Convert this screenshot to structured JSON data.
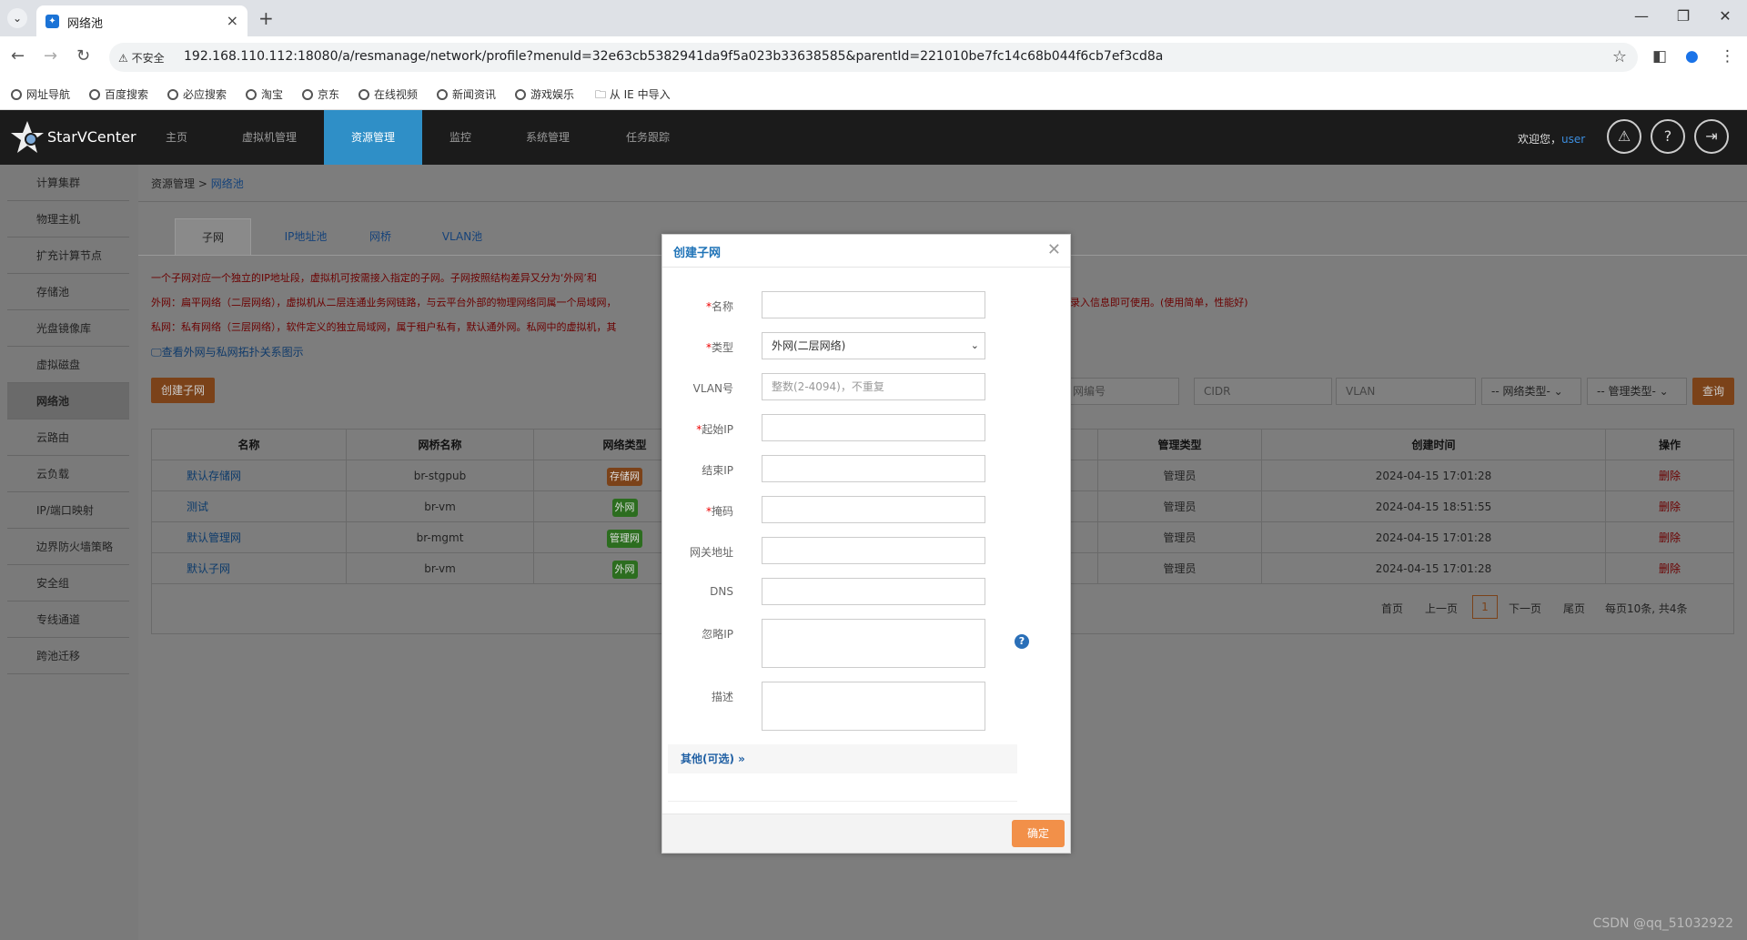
{
  "browser": {
    "tab_title": "网络池",
    "security_label": "不安全",
    "url": "192.168.110.112:18080/a/resmanage/network/profile?menuId=32e63cb5382941da9f5a023b33638585&parentId=221010be7fc14c68b044f6cb7ef3cd8a",
    "bookmarks": [
      "网址导航",
      "百度搜索",
      "必应搜索",
      "淘宝",
      "京东",
      "在线视频",
      "新闻资讯",
      "游戏娱乐",
      "从 IE 中导入"
    ]
  },
  "header": {
    "logo_text": "StarVCenter",
    "nav": [
      "主页",
      "虚拟机管理",
      "资源管理",
      "监控",
      "系统管理",
      "任务跟踪"
    ],
    "active_nav": "资源管理",
    "welcome": "欢迎您，",
    "user": "user"
  },
  "sidebar": {
    "items": [
      "计算集群",
      "物理主机",
      "扩充计算节点",
      "存储池",
      "光盘镜像库",
      "虚拟磁盘",
      "网络池",
      "云路由",
      "云负载",
      "IP/端口映射",
      "边界防火墙策略",
      "安全组",
      "专线通道",
      "跨池迁移"
    ],
    "active": "网络池"
  },
  "breadcrumb": {
    "parent": "资源管理",
    "sep": ">",
    "current": "网络池"
  },
  "subtabs": [
    "子网",
    "IP地址池",
    "网桥",
    "VLAN池"
  ],
  "description": {
    "line1": "一个子网对应一个独立的IP地址段，虚拟机可按需接入指定的子网。子网按照结构差异又分为‘外网’和",
    "line2": "外网：扁平网络（二层网络），虚拟机从二层连通业务网链路，与云平台外部的物理网络同属一个局域网，",
    "line2_tail": "录入信息即可使用。(使用简单，性能好)",
    "line3": "私网：私有网络（三层网络），软件定义的独立局域网，属于租户私有，默认通外网。私网中的虚拟机，其",
    "topology_link": "查看外网与私网拓扑关系图示"
  },
  "toolbar": {
    "create_label": "创建子网",
    "filter_placeholders": [
      "网编号",
      "CIDR",
      "VLAN"
    ],
    "select_net_type": "-- 网络类型-",
    "select_mgmt_type": "-- 管理类型-",
    "query_label": "查询"
  },
  "table": {
    "columns": [
      "名称",
      "网桥名称",
      "网络类型",
      "管理类型",
      "创建时间",
      "操作"
    ],
    "rows": [
      {
        "name": "默认存储网",
        "bridge": "br-stgpub",
        "type": "存储网",
        "type_color": "#7b4219",
        "mgmt": "管理员",
        "time": "2024-04-15 17:01:28",
        "action": "删除"
      },
      {
        "name": "测试",
        "bridge": "br-vm",
        "type": "外网",
        "type_color": "#2c6d1f",
        "mgmt": "管理员",
        "time": "2024-04-15 18:51:55",
        "action": "删除"
      },
      {
        "name": "默认管理网",
        "bridge": "br-mgmt",
        "type": "管理网",
        "type_color": "#2c6d1f",
        "mgmt": "管理员",
        "time": "2024-04-15 17:01:28",
        "action": "删除"
      },
      {
        "name": "默认子网",
        "bridge": "br-vm",
        "type": "外网",
        "type_color": "#2c6d1f",
        "mgmt": "管理员",
        "time": "2024-04-15 17:01:28",
        "action": "删除"
      }
    ]
  },
  "pagination": {
    "first": "首页",
    "prev": "上一页",
    "current": "1",
    "next": "下一页",
    "last": "尾页",
    "summary": "每页10条, 共4条"
  },
  "watermark": "CSDN @qq_51032922",
  "modal": {
    "title": "创建子网",
    "fields": {
      "name": {
        "label": "名称",
        "required": true,
        "value": ""
      },
      "type": {
        "label": "类型",
        "required": true,
        "value": "外网(二层网络)"
      },
      "vlan": {
        "label": "VLAN号",
        "required": false,
        "placeholder": "整数(2-4094)，不重复"
      },
      "start_ip": {
        "label": "起始IP",
        "required": true,
        "value": ""
      },
      "end_ip": {
        "label": "结束IP",
        "required": false,
        "value": ""
      },
      "mask": {
        "label": "掩码",
        "required": true,
        "value": ""
      },
      "gateway": {
        "label": "网关地址",
        "required": false,
        "value": ""
      },
      "dns": {
        "label": "DNS",
        "required": false,
        "value": ""
      },
      "ignore_ip": {
        "label": "忽略IP",
        "required": false,
        "value": ""
      },
      "desc": {
        "label": "描述",
        "required": false,
        "value": ""
      }
    },
    "other_label": "其他(可选)",
    "confirm_label": "确定"
  }
}
